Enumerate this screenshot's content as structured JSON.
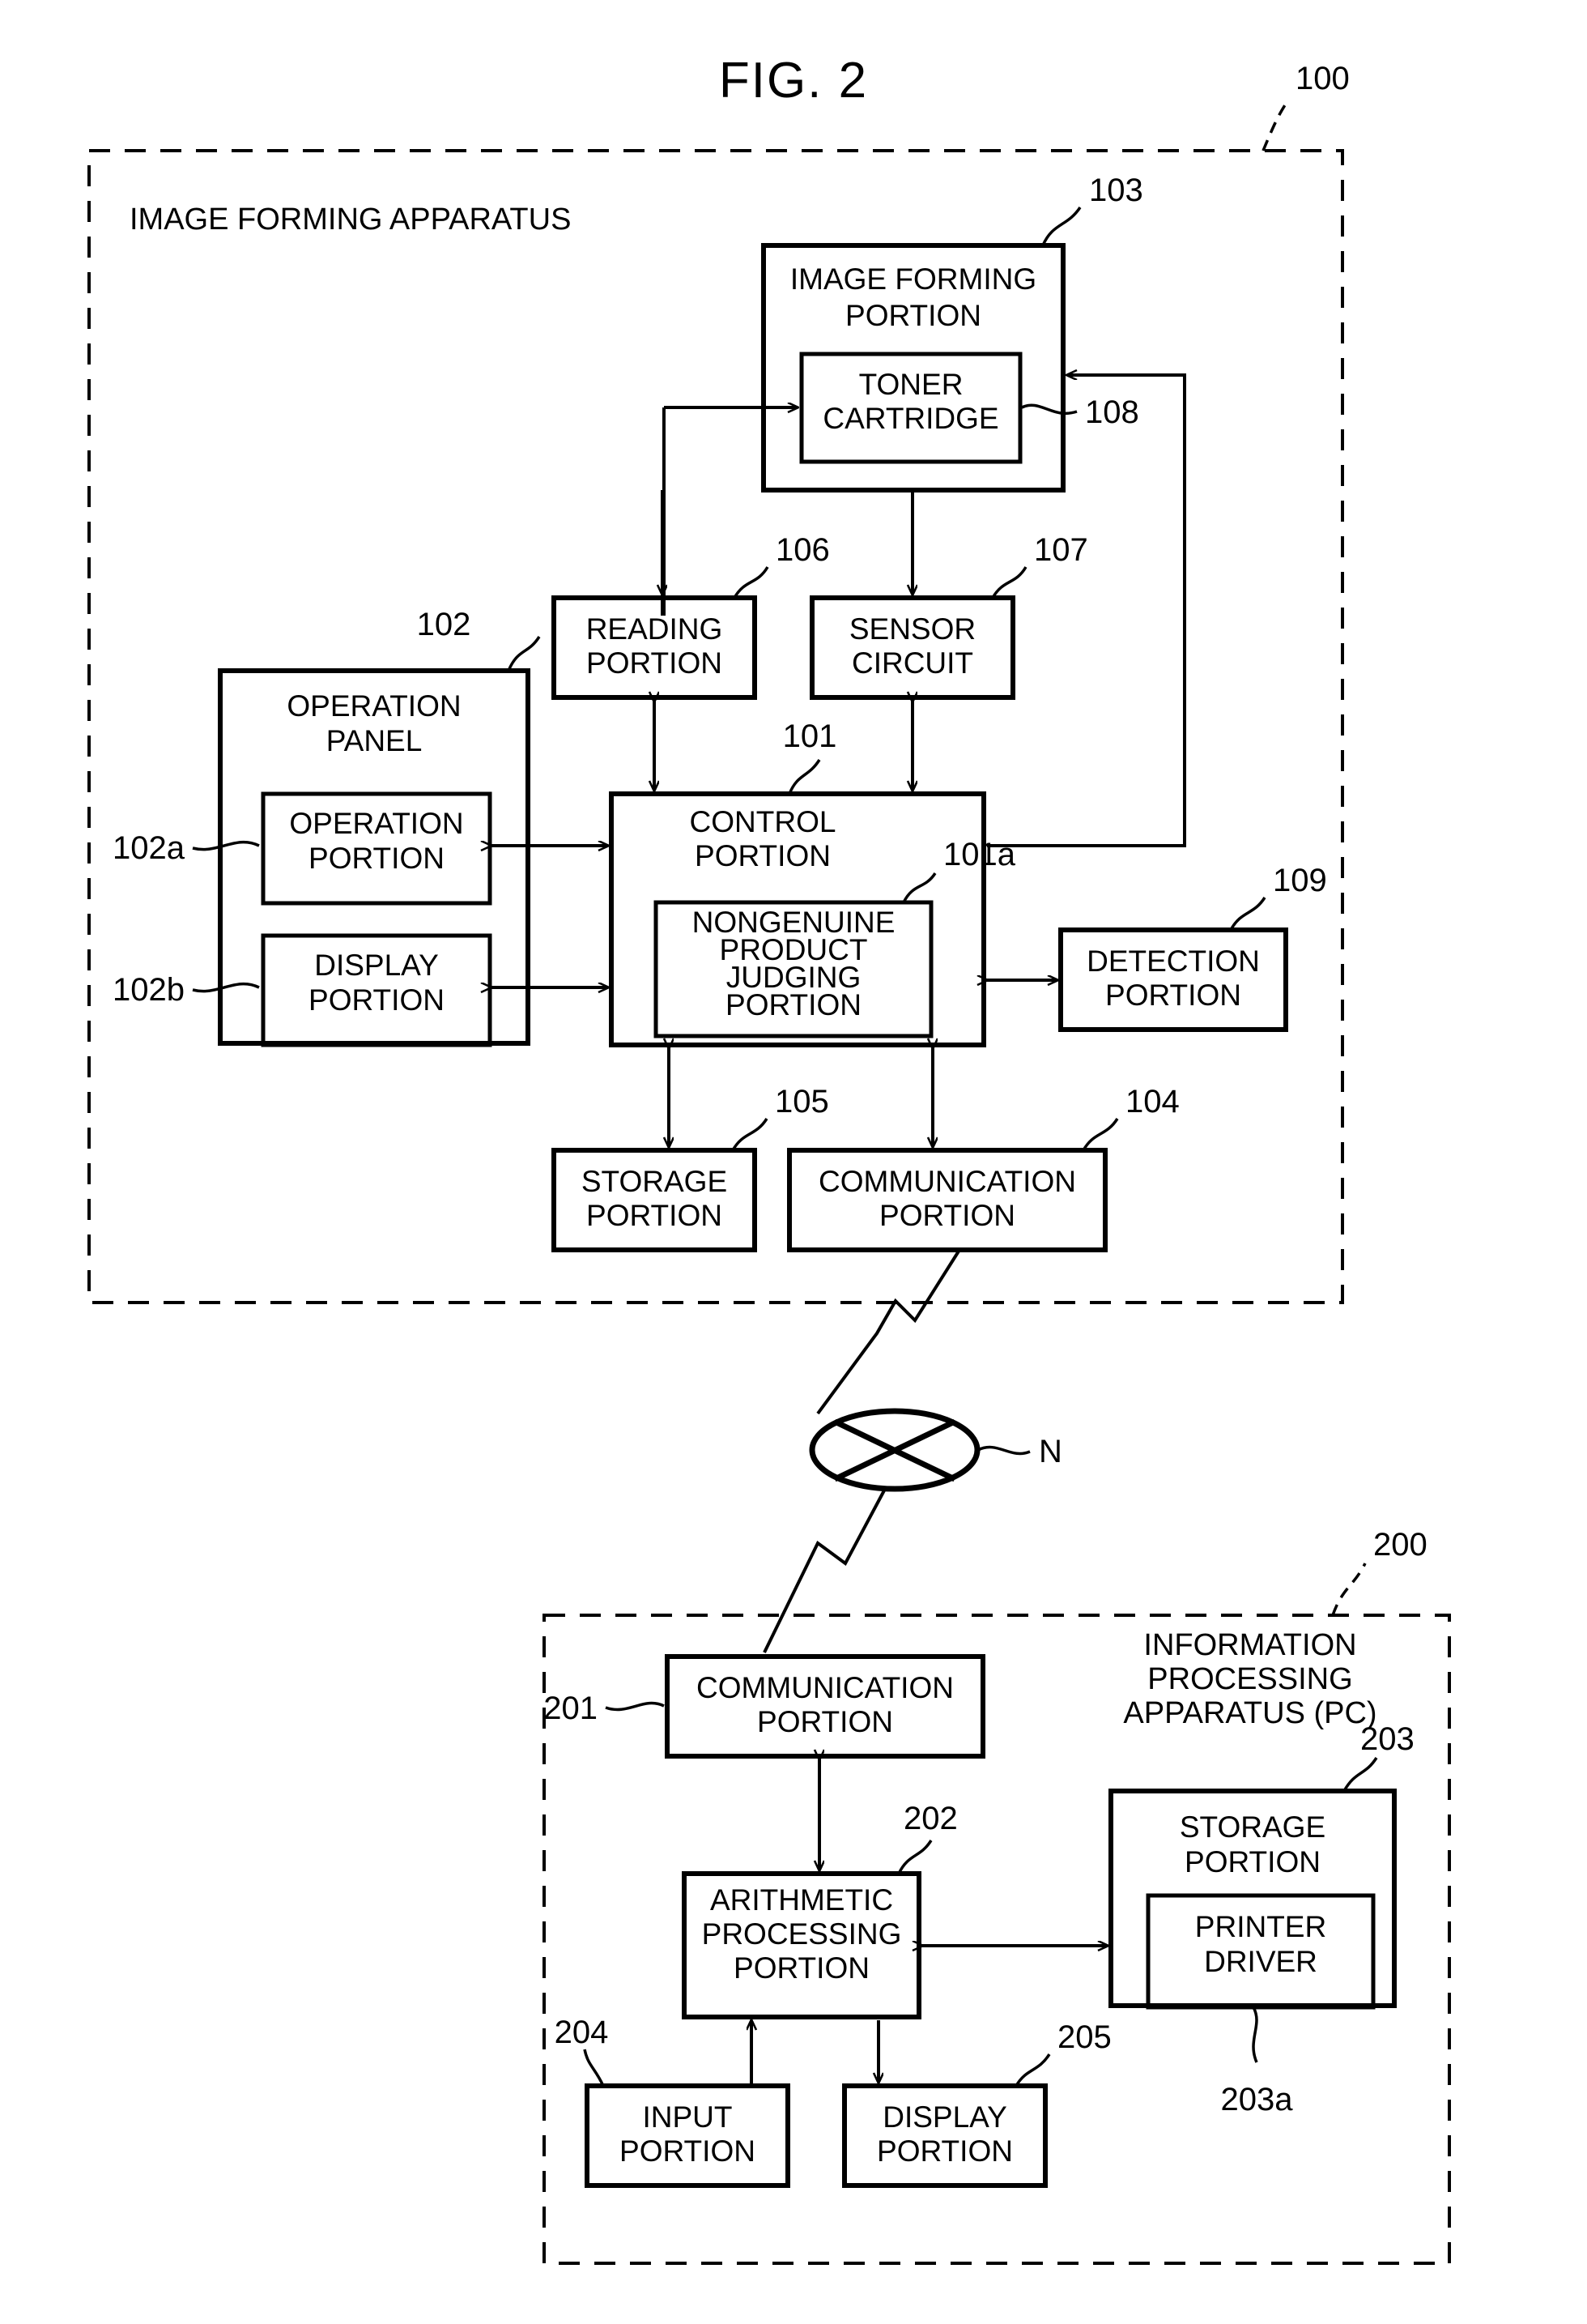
{
  "figure": {
    "title": "FIG. 2",
    "network_label": "N"
  },
  "apparatus_100": {
    "ref": "100",
    "label": "IMAGE FORMING APPARATUS",
    "blocks": {
      "image_forming_portion": {
        "ref": "103",
        "line1": "IMAGE FORMING",
        "line2": "PORTION"
      },
      "toner_cartridge": {
        "ref": "108",
        "line1": "TONER",
        "line2": "CARTRIDGE"
      },
      "reading_portion": {
        "ref": "106",
        "line1": "READING",
        "line2": "PORTION"
      },
      "sensor_circuit": {
        "ref": "107",
        "line1": "SENSOR",
        "line2": "CIRCUIT"
      },
      "operation_panel": {
        "ref": "102",
        "line1": "OPERATION",
        "line2": "PANEL"
      },
      "operation_portion": {
        "ref": "102a",
        "line1": "OPERATION",
        "line2": "PORTION"
      },
      "display_portion": {
        "ref": "102b",
        "line1": "DISPLAY",
        "line2": "PORTION"
      },
      "control_portion": {
        "ref": "101",
        "line1": "CONTROL",
        "line2": "PORTION"
      },
      "nongenuine_judging_portion": {
        "ref": "101a",
        "line1": "NONGENUINE",
        "line2": "PRODUCT",
        "line3": "JUDGING",
        "line4": "PORTION"
      },
      "detection_portion": {
        "ref": "109",
        "line1": "DETECTION",
        "line2": "PORTION"
      },
      "storage_portion": {
        "ref": "105",
        "line1": "STORAGE",
        "line2": "PORTION"
      },
      "communication_portion": {
        "ref": "104",
        "line1": "COMMUNICATION",
        "line2": "PORTION"
      }
    }
  },
  "apparatus_200": {
    "ref": "200",
    "label_line1": "INFORMATION",
    "label_line2": "PROCESSING",
    "label_line3": "APPARATUS (PC)",
    "blocks": {
      "communication_portion": {
        "ref": "201",
        "line1": "COMMUNICATION",
        "line2": "PORTION"
      },
      "arithmetic_processing_portion": {
        "ref": "202",
        "line1": "ARITHMETIC",
        "line2": "PROCESSING",
        "line3": "PORTION"
      },
      "storage_portion": {
        "ref": "203",
        "line1": "STORAGE",
        "line2": "PORTION"
      },
      "printer_driver": {
        "ref": "203a",
        "line1": "PRINTER",
        "line2": "DRIVER"
      },
      "input_portion": {
        "ref": "204",
        "line1": "INPUT",
        "line2": "PORTION"
      },
      "display_portion": {
        "ref": "205",
        "line1": "DISPLAY",
        "line2": "PORTION"
      }
    }
  }
}
